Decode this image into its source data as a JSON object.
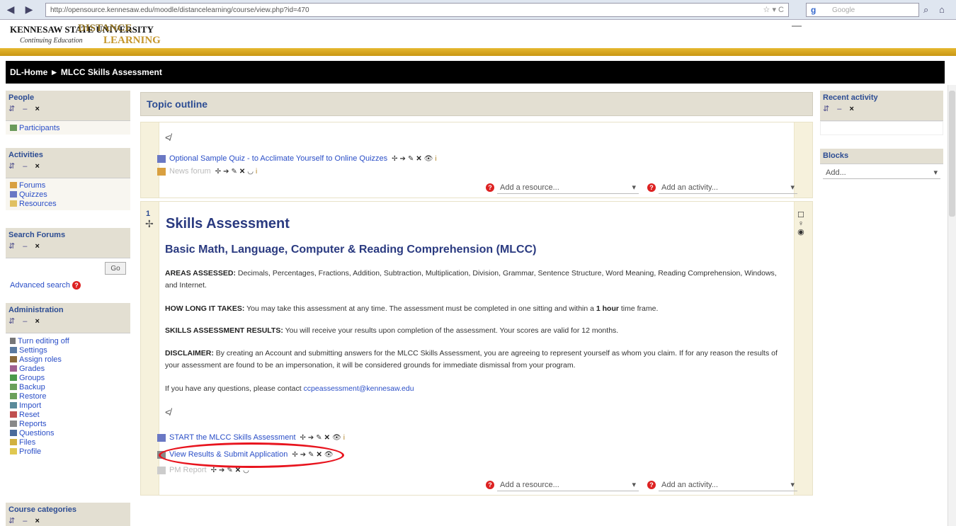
{
  "browser": {
    "back_glyph": "◀",
    "forward_glyph": "▶",
    "url": "http://opensource.kennesaw.edu/moodle/distancelearning/course/view.php?id=470",
    "url_controls": "☆ ▾ C",
    "search_engine": "g",
    "search_placeholder": "Google",
    "search_glyph": "⌕",
    "home_glyph": "⌂"
  },
  "site": {
    "logo_ksu": "KENNESAW STATE UNIVERSITY",
    "logo_ce": "Continuing Education",
    "logo_dl1": "DISTANCE",
    "logo_dl2": "LEARNING"
  },
  "breadcrumb": "DL-Home ► MLCC Skills Assessment",
  "left_blocks": {
    "people": {
      "title": "People",
      "items": [
        {
          "label": "Participants"
        }
      ]
    },
    "activities": {
      "title": "Activities",
      "items": [
        {
          "label": "Forums"
        },
        {
          "label": "Quizzes"
        },
        {
          "label": "Resources"
        }
      ]
    },
    "search_forums": {
      "title": "Search Forums",
      "go_label": "Go",
      "advanced_label": "Advanced search"
    },
    "administration": {
      "title": "Administration",
      "items": [
        {
          "label": "Turn editing off"
        },
        {
          "label": "Settings"
        },
        {
          "label": "Assign roles"
        },
        {
          "label": "Grades"
        },
        {
          "label": "Groups"
        },
        {
          "label": "Backup"
        },
        {
          "label": "Restore"
        },
        {
          "label": "Import"
        },
        {
          "label": "Reset"
        },
        {
          "label": "Reports"
        },
        {
          "label": "Questions"
        },
        {
          "label": "Files"
        },
        {
          "label": "Profile"
        }
      ]
    },
    "course_categories": {
      "title": "Course categories"
    }
  },
  "block_icons": {
    "move": "⇵",
    "dash": "–",
    "close": "×"
  },
  "right_blocks": {
    "recent_activity": {
      "title": "Recent activity"
    },
    "blocks": {
      "title": "Blocks",
      "select_value": "Add..."
    }
  },
  "main": {
    "title": "Topic outline",
    "section0": {
      "quiz_link": "Optional Sample Quiz - to Acclimate Yourself to Online Quizzes",
      "news_link": "News forum",
      "add_resource": "Add a resource...",
      "add_activity": "Add an activity..."
    },
    "section1": {
      "number": "1",
      "title": "Skills Assessment",
      "subtitle": "Basic Math, Language, Computer & Reading Comprehension (MLCC)",
      "areas_label": "AREAS ASSESSED:",
      "areas_text": " Decimals, Percentages, Fractions, Addition, Subtraction, Multiplication, Division, Grammar, Sentence Structure, Word Meaning, Reading Comprehension, Windows, and Internet.",
      "time_label": "HOW LONG IT TAKES:",
      "time_text": " You may take this assessment at any time. The assessment must be completed in one sitting and within a ",
      "time_bold": "1 hour",
      "time_end": " time frame.",
      "results_label": "SKILLS ASSESSMENT RESULTS:",
      "results_text": " You will receive your results upon completion of the assessment. Your scores are valid for 12 months.",
      "disclaimer_label": "DISCLAIMER:",
      "disclaimer_text": " By creating an Account and submitting answers for the MLCC Skills Assessment, you are agreeing to represent yourself as whom you claim. If for any reason the results of your assessment are found to be an impersonation, it will be considered grounds for immediate dismissal from your program.",
      "contact_text": "If you have any questions, please contact ",
      "contact_email": "ccpeassessment@kennesaw.edu",
      "start_link": "START the MLCC Skills Assessment",
      "view_link": "View Results & Submit Application",
      "pm_link": "PM Report",
      "add_resource": "Add a resource...",
      "add_activity": "Add an activity..."
    }
  },
  "edit_icons": {
    "move": "✢",
    "arrow": "➔",
    "edit": "✎",
    "delete": "✕",
    "show": "👁",
    "hide": "◡",
    "assign": "i"
  },
  "glyphs": {
    "indent": "≮",
    "move_section": "✢",
    "dropdown": "▾",
    "help": "?",
    "section_icons": [
      "☐",
      "♀",
      "◉"
    ]
  }
}
